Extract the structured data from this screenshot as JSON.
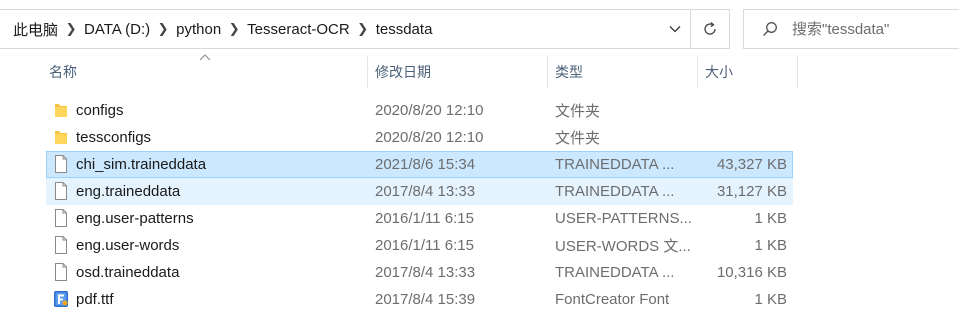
{
  "address": {
    "crumbs": [
      "此电脑",
      "DATA (D:)",
      "python",
      "Tesseract-OCR",
      "tessdata"
    ]
  },
  "search": {
    "placeholder": "搜索\"tessdata\""
  },
  "columns": {
    "name": "名称",
    "date": "修改日期",
    "type": "类型",
    "size": "大小"
  },
  "files": [
    {
      "name": "configs",
      "date": "2020/8/20 12:10",
      "type": "文件夹",
      "size": "",
      "icon": "folder-icon"
    },
    {
      "name": "tessconfigs",
      "date": "2020/8/20 12:10",
      "type": "文件夹",
      "size": "",
      "icon": "folder-icon"
    },
    {
      "name": "chi_sim.traineddata",
      "date": "2021/8/6 15:34",
      "type": "TRAINEDDATA ...",
      "size": "43,327 KB",
      "icon": "file-icon",
      "state": "selected"
    },
    {
      "name": "eng.traineddata",
      "date": "2017/8/4 13:33",
      "type": "TRAINEDDATA ...",
      "size": "31,127 KB",
      "icon": "file-icon",
      "state": "hover"
    },
    {
      "name": "eng.user-patterns",
      "date": "2016/1/11 6:15",
      "type": "USER-PATTERNS...",
      "size": "1 KB",
      "icon": "file-icon"
    },
    {
      "name": "eng.user-words",
      "date": "2016/1/11 6:15",
      "type": "USER-WORDS 文...",
      "size": "1 KB",
      "icon": "file-icon"
    },
    {
      "name": "osd.traineddata",
      "date": "2017/8/4 13:33",
      "type": "TRAINEDDATA ...",
      "size": "10,316 KB",
      "icon": "file-icon"
    },
    {
      "name": "pdf.ttf",
      "date": "2017/8/4 15:39",
      "type": "FontCreator Font",
      "size": "1 KB",
      "icon": "font-file-icon"
    }
  ],
  "colors": {
    "selected_bg": "#cce8ff",
    "selected_border": "#99d1ff",
    "hover_bg": "#e5f3ff",
    "header_text": "#4c607a",
    "folder": "#f5c343"
  }
}
